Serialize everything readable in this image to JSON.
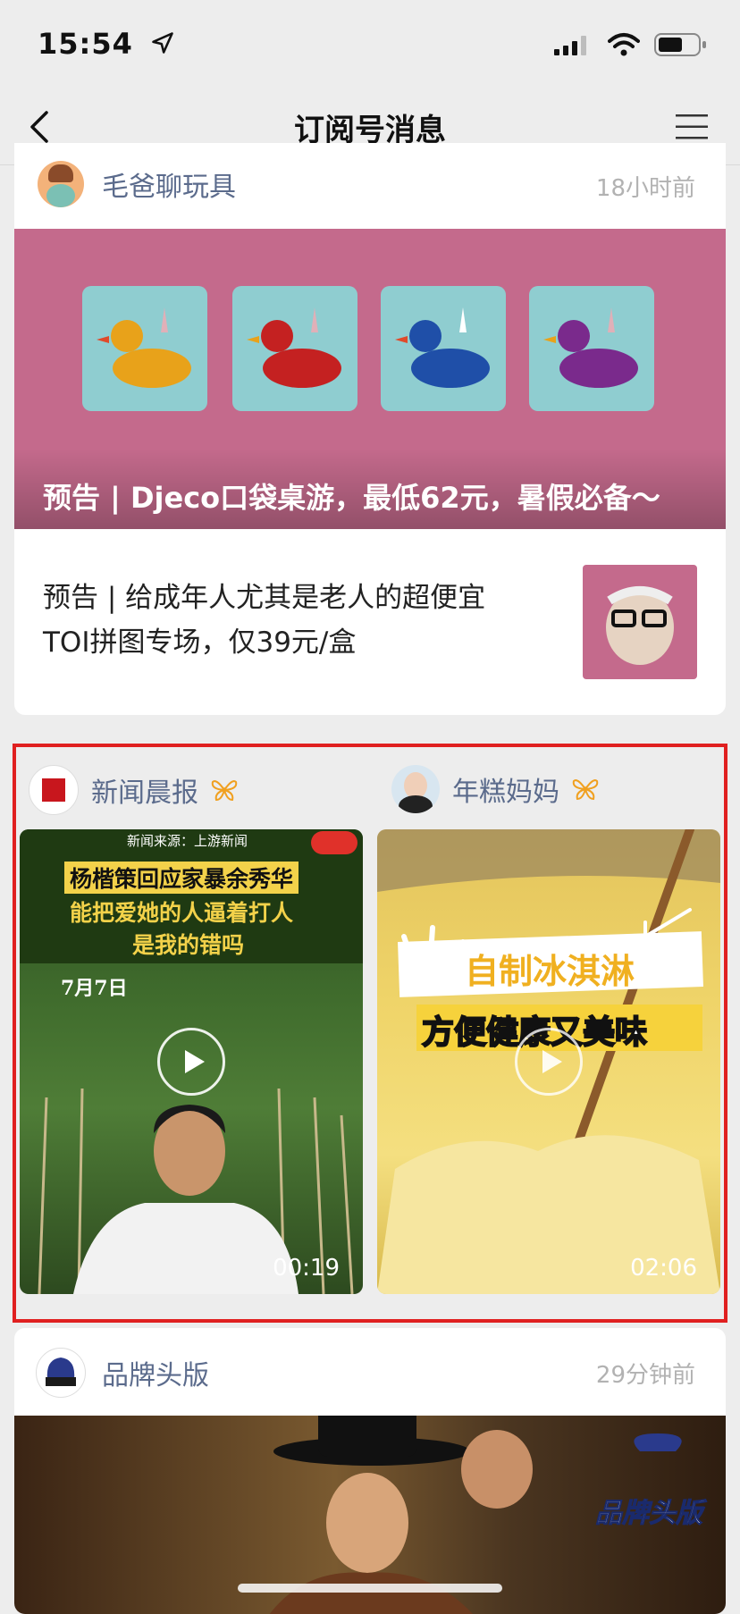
{
  "status": {
    "time": "15:54"
  },
  "nav": {
    "title": "订阅号消息"
  },
  "articles": {
    "account": "毛爸聊玩具",
    "time": "18小时前",
    "banner_caption": "预告 | Djeco口袋桌游，最低62元，暑假必备～",
    "second_title": "预告 | 给成年人尤其是老人的超便宜TOI拼图专场，仅39元/盒"
  },
  "videos": [
    {
      "account": "新闻晨报",
      "source": "新闻来源：上游新闻",
      "headline_1": "杨楷策回应家暴余秀华",
      "headline_2": "能把爱她的人逼着打人",
      "headline_3": "是我的错吗",
      "date": "7月7日",
      "duration": "00:19"
    },
    {
      "account": "年糕妈妈",
      "headline_1": "自制冰淇淋",
      "headline_2": "方便健康又美味",
      "duration": "02:06"
    }
  ],
  "brand": {
    "account": "品牌头版",
    "time": "29分钟前",
    "watermark": "品牌头版"
  },
  "colors": {
    "accent_link": "#5b6b8c",
    "highlight_box": "#e02020",
    "banner_pink": "#c46a8c"
  }
}
